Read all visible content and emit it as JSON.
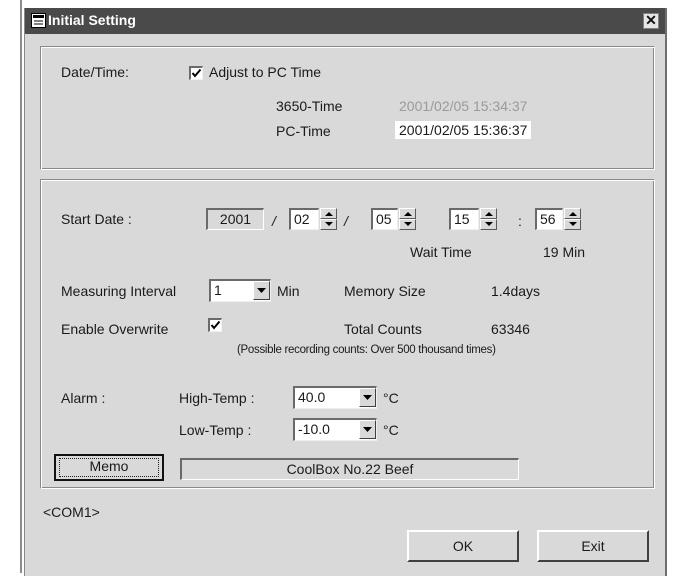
{
  "window": {
    "title": "Initial Setting",
    "close_glyph": "✕"
  },
  "datetime": {
    "label": "Date/Time:",
    "adjust_label": "Adjust to PC Time",
    "adjust_checked": true,
    "device_time_label": "3650-Time",
    "device_time_value": "2001/02/05  15:34:37",
    "pc_time_label": "PC-Time",
    "pc_time_value": "2001/02/05  15:36:37"
  },
  "start": {
    "label": "Start Date :",
    "year": "2001",
    "sep1": "/",
    "month": "02",
    "sep2": "/",
    "day": "05",
    "hour": "15",
    "time_sep": ":",
    "minute": "56",
    "wait_label": "Wait Time",
    "wait_value": "19 Min"
  },
  "measure": {
    "interval_label": "Measuring Interval",
    "interval_value": "1",
    "interval_unit": "Min",
    "memory_label": "Memory Size",
    "memory_value": "1.4days"
  },
  "overwrite": {
    "label": "Enable Overwrite",
    "checked": true,
    "total_label": "Total Counts",
    "total_value": "63346",
    "note": "(Possible recording counts: Over 500 thousand times)"
  },
  "alarm": {
    "label": "Alarm :",
    "high_label": "High-Temp :",
    "high_value": "40.0",
    "low_label": "Low-Temp :",
    "low_value": "-10.0",
    "unit": "°C"
  },
  "memo": {
    "button_label": "Memo",
    "text": "CoolBox No.22  Beef"
  },
  "footer": {
    "port": "<COM1>",
    "ok_label": "OK",
    "exit_label": "Exit"
  },
  "icons": [
    "window-icon",
    "close-icon",
    "check-icon",
    "spin-up-arrow-icon",
    "spin-down-arrow-icon",
    "dropdown-arrow-icon"
  ],
  "colors": {
    "titlebar": "#4a4a4a",
    "dialog": "#d9d9d9",
    "device_time_text": "#9a9a9a"
  }
}
